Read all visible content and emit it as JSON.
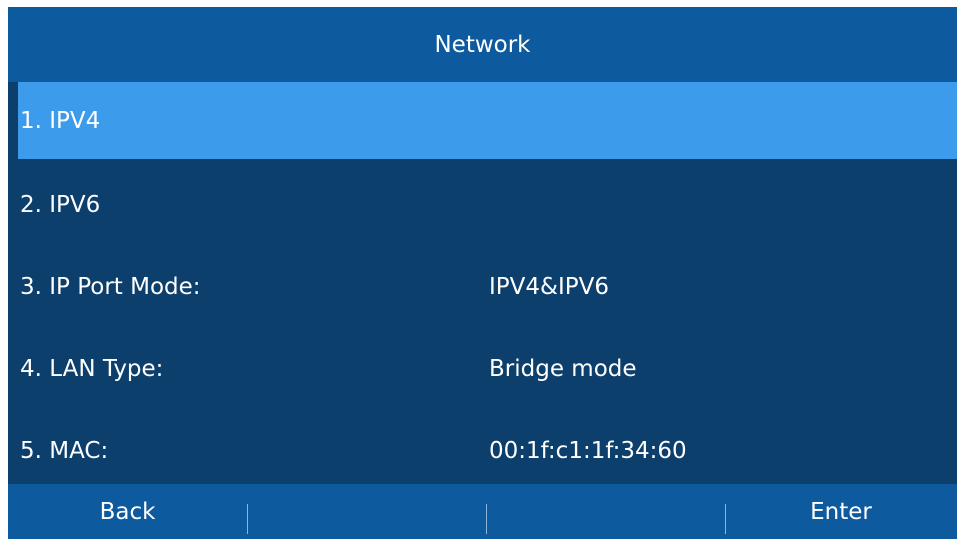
{
  "title": "Network",
  "menu": {
    "items": [
      {
        "label": "1. IPV4",
        "value": ""
      },
      {
        "label": "2. IPV6",
        "value": ""
      },
      {
        "label": "3. IP Port Mode:",
        "value": "IPV4&IPV6"
      },
      {
        "label": "4. LAN Type:",
        "value": "Bridge mode"
      },
      {
        "label": "5. MAC:",
        "value": "00:1f:c1:1f:34:60"
      }
    ],
    "selected_index": 0
  },
  "softkeys": [
    "Back",
    "",
    "",
    "Enter"
  ],
  "colors": {
    "title_bar": "#0d5a9e",
    "background": "#0c3f6c",
    "highlight": "#3c9ceb",
    "text": "#ffffff"
  }
}
